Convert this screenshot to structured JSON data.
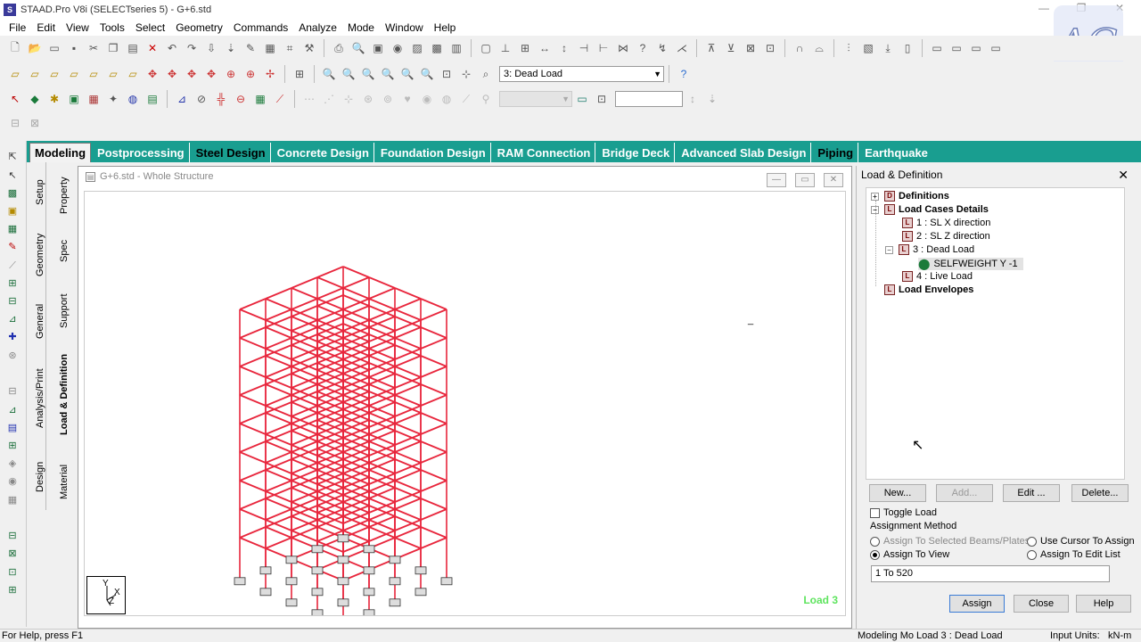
{
  "window": {
    "title": "STAAD.Pro V8i (SELECTseries 5) - G+6.std",
    "app_icon_glyph": "S"
  },
  "menu": [
    "File",
    "Edit",
    "View",
    "Tools",
    "Select",
    "Geometry",
    "Commands",
    "Analyze",
    "Mode",
    "Window",
    "Help"
  ],
  "logo_text": "AG",
  "toolbar": {
    "load_case_select": "3: Dead Load"
  },
  "ribbon_tabs": [
    {
      "label": "Modeling",
      "active": true
    },
    {
      "label": "Postprocessing",
      "active": false
    },
    {
      "label": "Steel Design",
      "active": false
    },
    {
      "label": "Concrete Design",
      "active": false
    },
    {
      "label": "Foundation Design",
      "active": false
    },
    {
      "label": "RAM Connection",
      "active": false
    },
    {
      "label": "Bridge Deck",
      "active": false
    },
    {
      "label": "Advanced Slab Design",
      "active": false
    },
    {
      "label": "Piping",
      "active": false
    },
    {
      "label": "Earthquake",
      "active": false
    }
  ],
  "vertical_tabs": {
    "outer": [
      "Setup",
      "Geometry",
      "General",
      "Analysis/Print",
      "Design"
    ],
    "inner": [
      "Property",
      "Spec",
      "Support",
      "Load & Definition",
      "Material"
    ]
  },
  "mdi": {
    "title": "G+6.std - Whole Structure",
    "load_label": "Load 3",
    "axis_y": "Y",
    "axis_x": "X",
    "axis_z": "Z"
  },
  "panel": {
    "title": "Load & Definition",
    "tree": {
      "definitions": "Definitions",
      "load_cases": "Load Cases Details",
      "case1": "1 : SL X direction",
      "case2": "2 : SL Z direction",
      "case3": "3 : Dead Load",
      "selfweight": "SELFWEIGHT Y -1",
      "case4": "4 : Live Load",
      "envelopes": "Load Envelopes"
    },
    "buttons": {
      "new": "New...",
      "add": "Add...",
      "edit": "Edit ...",
      "delete": "Delete..."
    },
    "toggle_load": "Toggle Load",
    "assignment_method": "Assignment Method",
    "options": {
      "selected_beams": "Assign To Selected Beams/Plates",
      "use_cursor": "Use Cursor To Assign",
      "assign_view": "Assign To View",
      "edit_list": "Assign To Edit List"
    },
    "range": "1 To 520",
    "assign": "Assign",
    "close": "Close",
    "help": "Help"
  },
  "status": {
    "help": "For Help, press F1",
    "mode": "Modeling Mo  Load 3 : Dead Load",
    "units_label": "Input Units:",
    "units_value": "kN-m"
  },
  "colors": {
    "frame": "#e8263c",
    "ribbon": "#199e90",
    "load_label": "#5ee45e"
  }
}
